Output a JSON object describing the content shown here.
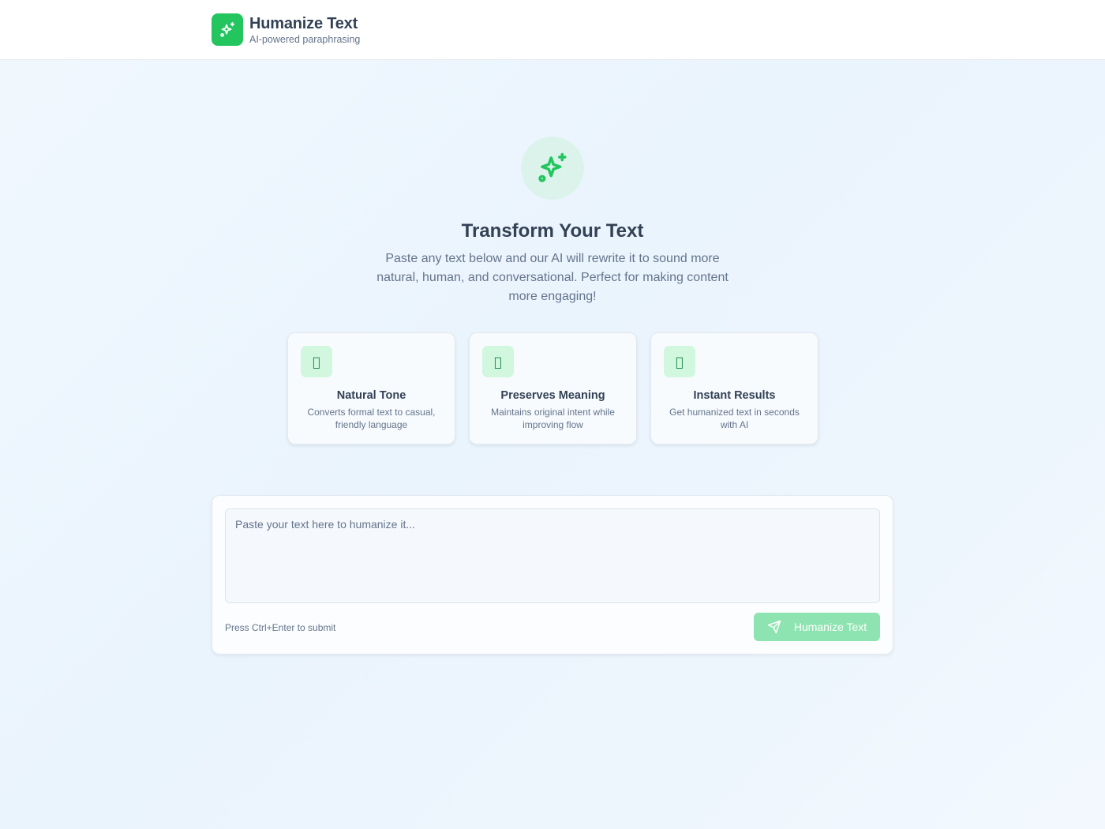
{
  "header": {
    "title": "Humanize Text",
    "subtitle": "AI-powered paraphrasing",
    "logo_icon": "sparkles-icon"
  },
  "hero": {
    "icon": "sparkles-icon",
    "title": "Transform Your Text",
    "description": "Paste any text below and our AI will rewrite it to sound more natural, human, and conversational. Perfect for making content more engaging!"
  },
  "features": [
    {
      "icon": "",
      "title": "Natural Tone",
      "description": "Converts formal text to casual, friendly language"
    },
    {
      "icon": "",
      "title": "Preserves Meaning",
      "description": "Maintains original intent while improving flow"
    },
    {
      "icon": "",
      "title": "Instant Results",
      "description": "Get humanized text in seconds with AI"
    }
  ],
  "input": {
    "value": "",
    "placeholder": "Paste your text here to humanize it...",
    "hint": "Press Ctrl+Enter to submit",
    "submit_label": "Humanize Text",
    "submit_icon": "send-icon"
  },
  "colors": {
    "accent": "#22c55e",
    "accent_disabled": "#8ee4b0",
    "icon_bg": "#dcf3ec",
    "feature_icon_bg": "#d1f7df"
  }
}
